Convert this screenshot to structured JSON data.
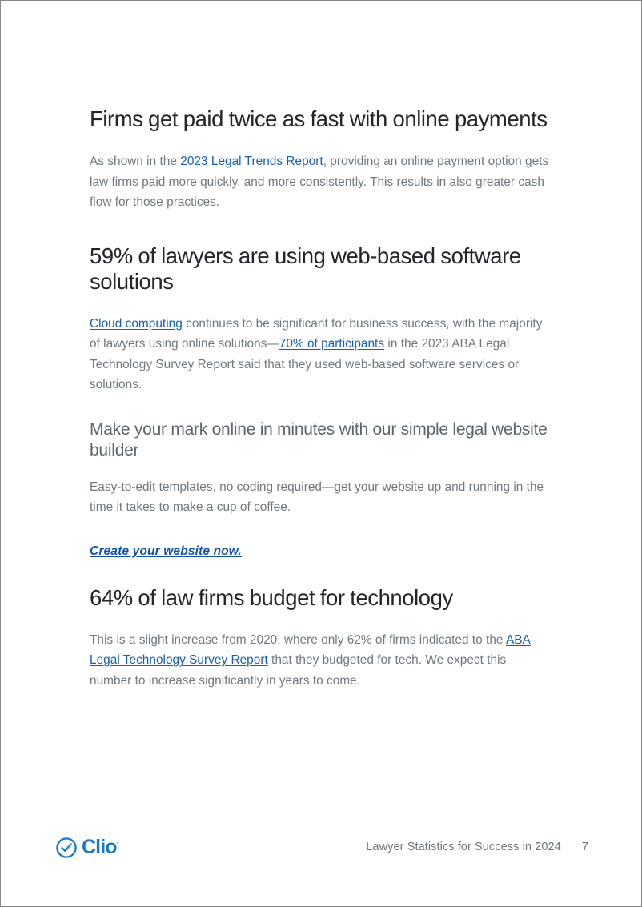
{
  "document": {
    "type": "pdf-page",
    "page_number": "7",
    "colors": {
      "heading": "#22262a",
      "body_text": "#70787f",
      "link": "#1a5fa8",
      "cta_link": "#1454a3",
      "brand_blue": "#1a7bc4",
      "page_border": "#868686",
      "background": "#ffffff"
    }
  },
  "sections": [
    {
      "id": "online-payments",
      "heading": "Firms get paid twice as fast with online payments",
      "paragraph": {
        "before": "As shown in the ",
        "link": "2023 Legal Trends Report",
        "after": ", providing an online payment option gets law firms paid more quickly, and more consistently. This results in also greater cash flow for those practices."
      }
    },
    {
      "id": "web-based-software",
      "heading": "59% of lawyers are using web-based software solutions",
      "paragraph": {
        "link1": "Cloud computing",
        "mid1": " continues to be significant for business success, with the majority of lawyers using online solutions—",
        "link2": "70% of participants",
        "after": " in the 2023 ABA Legal Technology Survey Report said that they used web-based software services or solutions."
      }
    },
    {
      "id": "website-builder",
      "subheading": "Make your mark online in minutes with our simple legal website builder",
      "paragraph": "Easy-to-edit templates, no coding required—get your website up and running in the time it takes to make a cup of coffee.",
      "cta": "Create your website now."
    },
    {
      "id": "technology-budget",
      "heading": "64% of law firms budget for technology",
      "paragraph": {
        "before": "This is a slight increase from 2020, where only 62% of firms indicated to the ",
        "link": "ABA Legal Technology Survey Report",
        "after": " that they budgeted for tech. We expect this number to increase significantly in years to come."
      }
    }
  ],
  "footer": {
    "logo_name": "Clio",
    "logo_trademark": "·",
    "logo_icon": "check-circle-icon",
    "document_title": "Lawyer Statistics for Success in 2024",
    "page_number": "7"
  }
}
